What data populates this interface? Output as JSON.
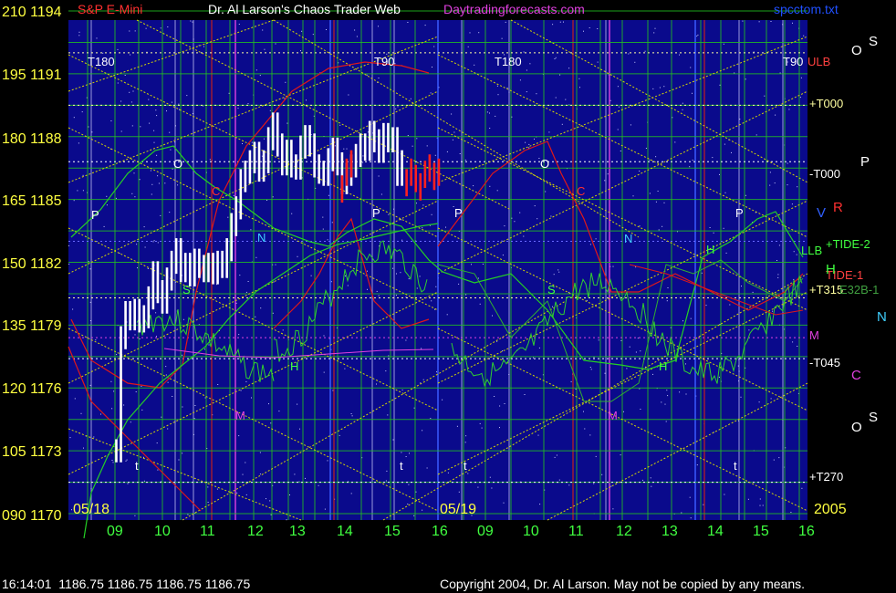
{
  "header": {
    "instrument": "S&P E-Mini",
    "author": "Dr. Al Larson's Chaos Trader Web",
    "site": "Daytradingforecasts.com",
    "file": "spcctom.txt",
    "year": "2005"
  },
  "colors": {
    "background": "#000000",
    "plot_background": "#0a0a8c",
    "grid_green": "#22c022",
    "diagonal_yellow": "#d8d800",
    "price_bars": "#ffffff",
    "forecast_bars": "#ff2020",
    "red_curve": "#e01818",
    "green_curve": "#24d024",
    "magenta": "#e040e0",
    "cyan": "#40d0ff"
  },
  "axes": {
    "y_left_labels": [
      "210 1194",
      "195 1191",
      "180 1188",
      "165 1185",
      "150 1182",
      "135 1179",
      "120 1176",
      "105 1173",
      "090 1170"
    ],
    "x_tick_labels": [
      "09",
      "10",
      "11",
      "12",
      "13",
      "14",
      "15",
      "16",
      "09",
      "10",
      "11",
      "12",
      "13",
      "14",
      "15",
      "16"
    ],
    "date_labels": [
      "05/18",
      "05/19"
    ]
  },
  "right_labels": [
    {
      "text": "ULB",
      "color": "#ff4040"
    },
    {
      "text": "+T000",
      "color": "#ffffa0"
    },
    {
      "text": "-T000",
      "color": "#ffffff"
    },
    {
      "text": "LLB",
      "color": "#40ff40"
    },
    {
      "text": "+TIDE-2",
      "color": "#40ff40"
    },
    {
      "text": "TIDE-1",
      "color": "#ff4040"
    },
    {
      "text": "+T315",
      "color": "#ffffa0"
    },
    {
      "text": "E32B-1",
      "color": "#40a040"
    },
    {
      "text": "M",
      "color": "#e040e0"
    },
    {
      "text": "-T045",
      "color": "#ffffff"
    },
    {
      "text": "+T270",
      "color": "#ffffff"
    }
  ],
  "side_letters": [
    {
      "text": "O",
      "color": "#ffffff"
    },
    {
      "text": "S",
      "color": "#ffffff"
    },
    {
      "text": "P",
      "color": "#ffffff"
    },
    {
      "text": "R",
      "color": "#ff3030"
    },
    {
      "text": "V",
      "color": "#3060ff"
    },
    {
      "text": "H",
      "color": "#40ff40"
    },
    {
      "text": "N",
      "color": "#40d0ff"
    },
    {
      "text": "C",
      "color": "#e040e0"
    },
    {
      "text": "O",
      "color": "#ffffff"
    },
    {
      "text": "S",
      "color": "#ffffff"
    }
  ],
  "in_chart_labels": [
    {
      "text": "T180",
      "color": "#ffffff"
    },
    {
      "text": "T90",
      "color": "#ffffff"
    },
    {
      "text": "T180",
      "color": "#ffffff"
    },
    {
      "text": "T90",
      "color": "#ffffff"
    },
    {
      "text": "P",
      "color": "#ffffff"
    },
    {
      "text": "O",
      "color": "#ffffff"
    },
    {
      "text": "C",
      "color": "#ff3030"
    },
    {
      "text": "N",
      "color": "#40d0ff"
    },
    {
      "text": "S",
      "color": "#40ff40"
    },
    {
      "text": "H",
      "color": "#40ff40"
    },
    {
      "text": "M",
      "color": "#e040e0"
    },
    {
      "text": "P",
      "color": "#ffffff"
    },
    {
      "text": "t",
      "color": "#ffffff"
    },
    {
      "text": "t",
      "color": "#ffffff"
    },
    {
      "text": "P",
      "color": "#ffffff"
    },
    {
      "text": "O",
      "color": "#ffffff"
    },
    {
      "text": "C",
      "color": "#ff3030"
    },
    {
      "text": "N",
      "color": "#40d0ff"
    },
    {
      "text": "S",
      "color": "#40ff40"
    },
    {
      "text": "H",
      "color": "#40ff40"
    },
    {
      "text": "M",
      "color": "#e040e0"
    },
    {
      "text": "P",
      "color": "#ffffff"
    },
    {
      "text": "H",
      "color": "#40ff40"
    },
    {
      "text": "t",
      "color": "#ffffff"
    },
    {
      "text": "t",
      "color": "#ffffff"
    }
  ],
  "status_bar": {
    "time": "16:14:01",
    "open": "1186.75",
    "high": "1186.75",
    "low": "1186.75",
    "close": "1186.75"
  },
  "copyright": "Copyright 2004, Dr. Al Larson. May not be copied by any means.",
  "chart_data": {
    "type": "bar",
    "ylim": [
      1170,
      1194
    ],
    "x_label_sessions": [
      "05/18",
      "05/19"
    ],
    "price_bars": {
      "x_hours_0518": [
        8.95,
        9.05,
        9.15,
        9.25,
        9.35,
        9.45,
        9.55,
        9.65,
        9.75,
        9.85,
        9.95,
        10.05,
        10.15,
        10.25,
        10.35,
        10.45,
        10.55,
        10.65,
        10.75,
        10.85,
        10.95,
        11.05,
        11.15,
        11.25,
        11.35,
        11.45,
        11.55,
        11.65,
        11.75,
        11.85,
        11.95,
        12.05,
        12.15,
        12.25,
        12.35,
        12.45,
        12.55,
        12.65,
        12.75,
        12.85,
        12.95,
        13.05,
        13.15,
        13.25,
        13.35,
        13.45,
        13.55,
        13.65,
        13.75,
        13.85,
        13.95,
        14.05,
        14.15,
        14.25,
        14.35,
        14.45,
        14.55,
        14.65,
        14.75,
        14.85,
        14.95,
        15.05,
        15.15
      ],
      "close": [
        1173.0,
        1178.4,
        1179.6,
        1179.3,
        1179.7,
        1179.2,
        1179.4,
        1180.3,
        1181.5,
        1180.6,
        1180.1,
        1181.2,
        1182.0,
        1182.6,
        1181.6,
        1181.9,
        1181.4,
        1182.1,
        1181.8,
        1181.6,
        1181.9,
        1181.5,
        1182.0,
        1181.8,
        1182.6,
        1183.8,
        1184.6,
        1185.9,
        1186.3,
        1186.8,
        1187.2,
        1186.4,
        1186.8,
        1187.9,
        1188.6,
        1187.6,
        1186.7,
        1187.3,
        1186.6,
        1186.5,
        1187.5,
        1188.0,
        1187.6,
        1186.6,
        1186.3,
        1186.2,
        1186.9,
        1187.4,
        1186.7,
        1185.8,
        1186.2,
        1186.6,
        1187.1,
        1187.6,
        1187.4,
        1188.2,
        1187.8,
        1187.3,
        1188.1,
        1187.8,
        1187.9,
        1186.2,
        1186.8
      ]
    },
    "forecast_bars": {
      "x_hours_0518": [
        13.85,
        13.95,
        14.05,
        15.25,
        15.35,
        15.45,
        15.55,
        15.65,
        15.75,
        15.85,
        15.95
      ],
      "close": [
        1185.6,
        1186.4,
        1186.8,
        1185.9,
        1186.4,
        1186.1,
        1185.7,
        1186.3,
        1186.6,
        1186.2,
        1186.4
      ]
    }
  }
}
